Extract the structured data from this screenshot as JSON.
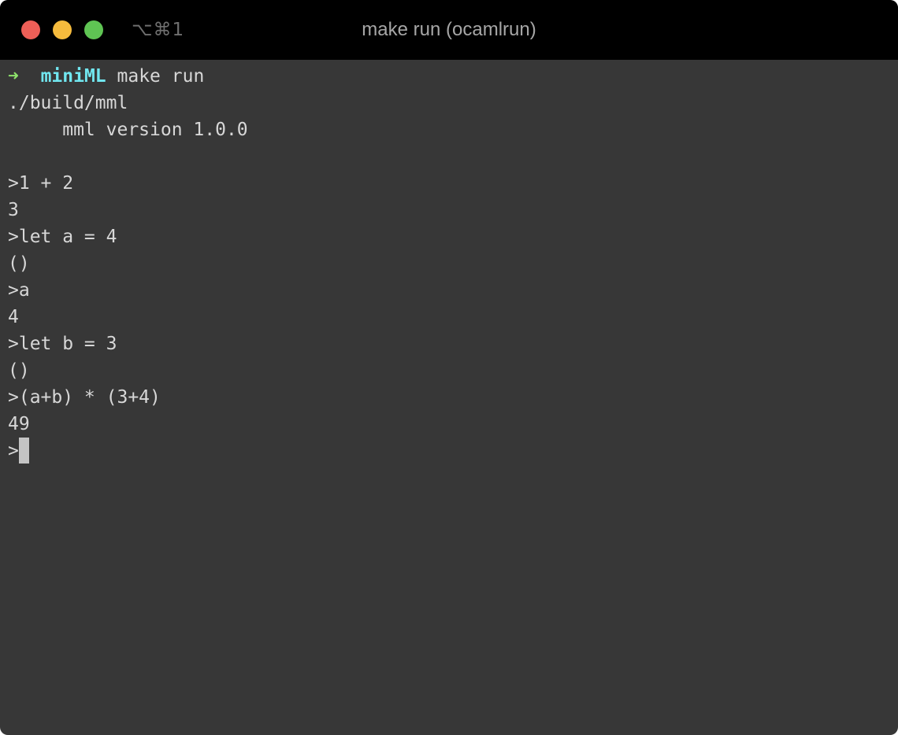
{
  "window": {
    "title": "make run (ocamlrun)",
    "shortcut": "⌥⌘1"
  },
  "terminal": {
    "prompt": {
      "arrow": "➜",
      "directory": "miniML",
      "command": "make run"
    },
    "lines": [
      "./build/mml",
      "     mml version 1.0.0",
      "",
      ">1 + 2",
      "3",
      ">let a = 4",
      "()",
      ">a",
      "4",
      ">let b = 3",
      "()",
      ">(a+b) * (3+4)",
      "49"
    ],
    "input_prompt": ">"
  },
  "colors": {
    "background": "#373737",
    "titlebar": "#000000",
    "text": "#d7d7d7",
    "prompt_arrow": "#8ee36b",
    "prompt_directory": "#71e6ef",
    "close_button": "#ee5f57",
    "minimize_button": "#f6bb3d",
    "zoom_button": "#5fc453"
  }
}
